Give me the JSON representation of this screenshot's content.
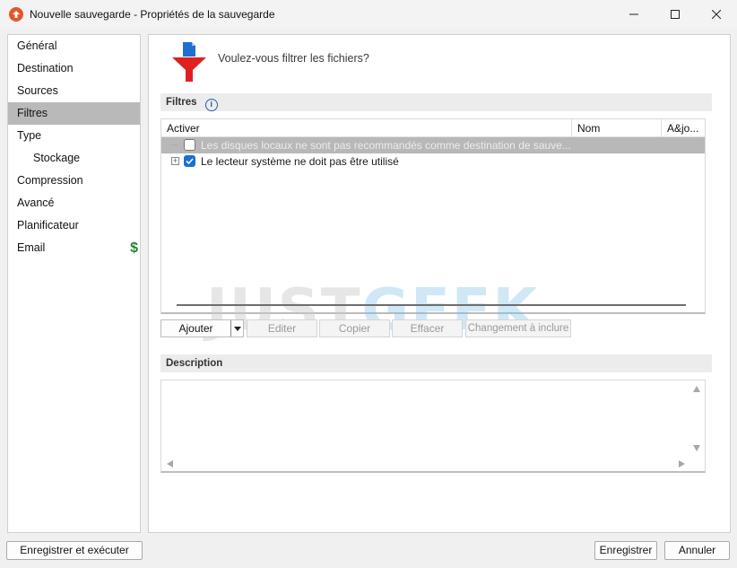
{
  "window": {
    "title": "Nouvelle sauvegarde - Propriétés de la sauvegarde",
    "app_icon": "cloud-upload-icon"
  },
  "sidebar": {
    "items": [
      {
        "label": "Général",
        "active": false,
        "sub": false
      },
      {
        "label": "Destination",
        "active": false,
        "sub": false
      },
      {
        "label": "Sources",
        "active": false,
        "sub": false
      },
      {
        "label": "Filtres",
        "active": true,
        "sub": false
      },
      {
        "label": "Type",
        "active": false,
        "sub": false
      },
      {
        "label": "Stockage",
        "active": false,
        "sub": true
      },
      {
        "label": "Compression",
        "active": false,
        "sub": false
      },
      {
        "label": "Avancé",
        "active": false,
        "sub": false
      },
      {
        "label": "Planificateur",
        "active": false,
        "sub": false
      },
      {
        "label": "Email",
        "active": false,
        "sub": false,
        "badge_icon": "dollar-icon",
        "badge_text": "$"
      }
    ]
  },
  "main": {
    "question": "Voulez-vous filtrer les fichiers?",
    "filters_section": "Filtres",
    "columns": [
      "Activer",
      "Nom",
      "A&jo..."
    ],
    "rows": [
      {
        "text": "Les disques locaux ne sont pas recommandés comme destination de sauve...",
        "checked": false,
        "disabled": true
      },
      {
        "text": "Le lecteur système ne doit pas être utilisé",
        "checked": true,
        "disabled": false
      }
    ],
    "watermark": {
      "part1": "JUST",
      "part2": "GEEK"
    },
    "buttons": {
      "ajouter": "Ajouter",
      "editer": "Editer",
      "copier": "Copier",
      "effacer": "Effacer",
      "changement": "Changement à inclure"
    },
    "description_section": "Description",
    "description_text": ""
  },
  "footer": {
    "save_run": "Enregistrer et exécuter",
    "save": "Enregistrer",
    "cancel": "Annuler"
  },
  "colors": {
    "accent": "#1a6fd0",
    "funnel": "#e02020",
    "dollar": "#1d8a2e",
    "selected_nav": "#b9b9b9"
  }
}
